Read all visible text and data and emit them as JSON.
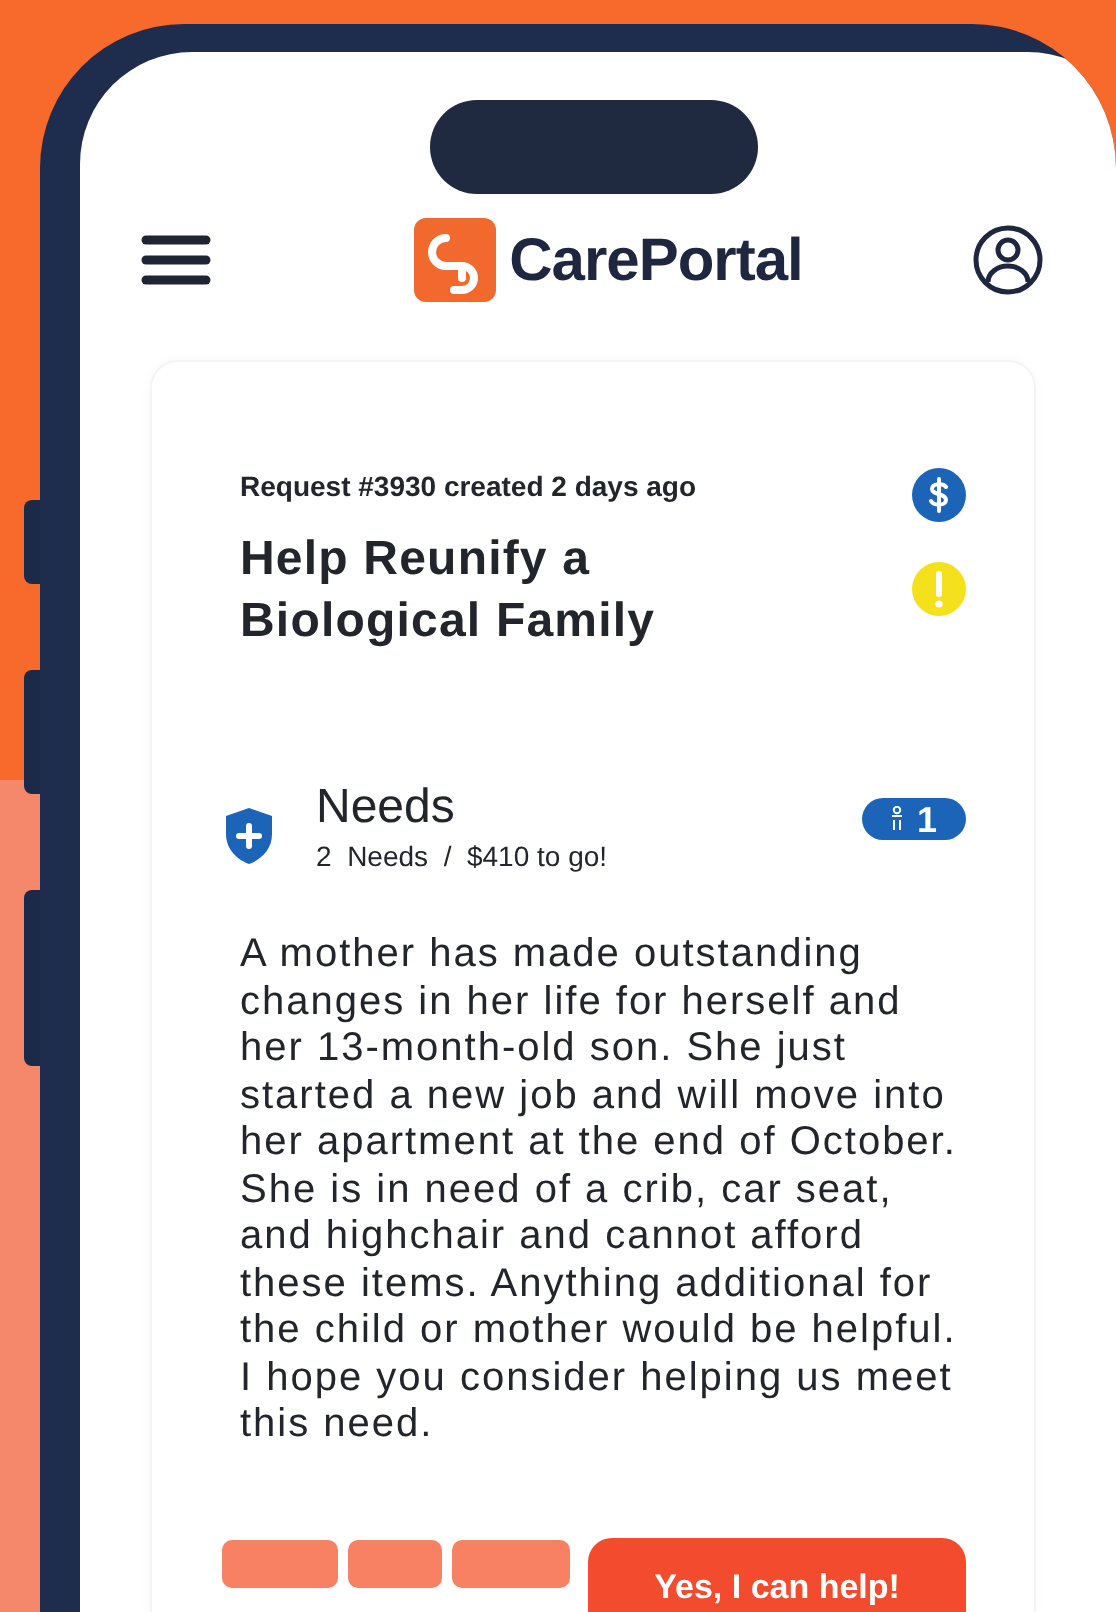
{
  "app_bar": {
    "brand": "CarePortal"
  },
  "request": {
    "meta": "Request #3930 created 2 days ago",
    "title": "Help Reunify a Biological Family"
  },
  "needs": {
    "heading": "Needs",
    "summary": "2  Needs  /  $410 to go!",
    "badge_count": "1"
  },
  "description": "A mother has made outstanding changes in her life for herself and her 13-month-old son. She just started a new job and will move into her apartment at the end of October. She is in need of a crib, car seat, and highchair and cannot afford these items. Anything additional for the child or mother would be helpful. I hope you consider helping us meet this need.",
  "actions": {
    "primary": "Yes, I can help!"
  }
}
